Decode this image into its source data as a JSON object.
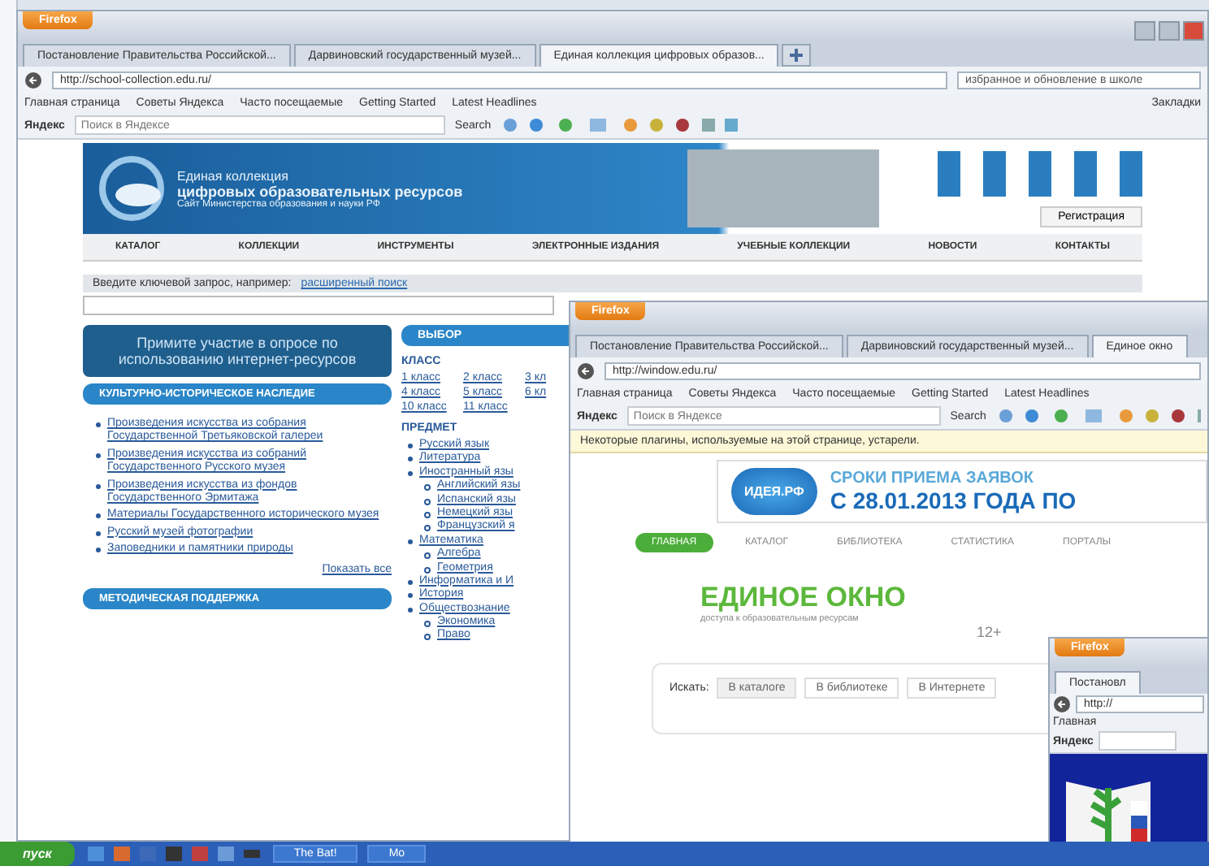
{
  "windows": [
    {
      "kind": "collection",
      "firefox_button": "Firefox",
      "tabs": [
        {
          "label": "Постановление Правительства Российской...",
          "selected": false
        },
        {
          "label": "Дарвиновский государственный музей...",
          "selected": false
        },
        {
          "label": "Единая коллекция цифровых образов...",
          "selected": true
        }
      ],
      "address": "http://school-collection.edu.ru/",
      "search_field": "избранное и обновление в школе",
      "bookmarks": [
        "Главная страница",
        "Советы Яндекса",
        "Часто посещаемые",
        "Getting Started",
        "Latest Headlines"
      ],
      "bookmarks_button": "Закладки",
      "yandex": {
        "label": "Яндекс",
        "placeholder": "Поиск в Яндексе",
        "search": "Search"
      },
      "page": {
        "header": {
          "title": "Единая коллекция",
          "subtitle": "цифровых образовательных ресурсов",
          "tagline": "Сайт Министерства образования и науки РФ",
          "register": "Регистрация"
        },
        "nav": [
          "КАТАЛОГ",
          "КОЛЛЕКЦИИ",
          "ИНСТРУМЕНТЫ",
          "ЭЛЕКТРОННЫЕ ИЗДАНИЯ",
          "УЧЕБНЫЕ КОЛЛЕКЦИИ",
          "НОВОСТИ",
          "КОНТАКТЫ"
        ],
        "search": {
          "label": "Введите ключевой запрос, например:",
          "link": "расширенный поиск"
        },
        "banner": "Примите участие в опросе по использованию интернет-ресурсов",
        "sections": [
          {
            "title": "КУЛЬТУРНО-ИСТОРИЧЕСКОЕ НАСЛЕДИЕ",
            "links": [
              "Произведения искусства из собрания Государственной Третьяковской галереи",
              "Произведения искусства из собраний Государственного Русского музея",
              "Произведения искусства из фондов Государственного Эрмитажа",
              "Материалы Государственного исторического музея",
              "Русский музей фотографии",
              "Заповедники и памятники природы"
            ],
            "more": "Показать все"
          },
          {
            "title": "МЕТОДИЧЕСКАЯ ПОДДЕРЖКА"
          }
        ],
        "sidebar": {
          "title": "ВЫБОР",
          "class_heading": "КЛАСС",
          "classes": [
            "1 класс",
            "2 класс",
            "3 кл",
            "4 класс",
            "5 класс",
            "6 кл",
            "10 класс",
            "11 класс"
          ],
          "subject_heading": "ПРЕДМЕТ",
          "subjects": [
            {
              "label": "Русский язык"
            },
            {
              "label": "Литература"
            },
            {
              "label": "Иностранный язы",
              "children": [
                {
                  "label": "Английский язы"
                },
                {
                  "label": "Испанский язы"
                },
                {
                  "label": "Немецкий язы"
                },
                {
                  "label": "Французский я"
                }
              ]
            },
            {
              "label": "Математика",
              "children": [
                {
                  "label": "Алгебра"
                },
                {
                  "label": "Геометрия"
                }
              ]
            },
            {
              "label": "Информатика и И"
            },
            {
              "label": "История"
            },
            {
              "label": "Обществознание",
              "children": [
                {
                  "label": "Экономика"
                },
                {
                  "label": "Право"
                }
              ]
            }
          ]
        }
      }
    },
    {
      "kind": "window",
      "firefox_button": "Firefox",
      "tabs": [
        {
          "label": "Постановление Правительства Российской...",
          "selected": false
        },
        {
          "label": "Дарвиновский государственный музей...",
          "selected": false
        },
        {
          "label": "Единое окно",
          "selected": true
        }
      ],
      "address": "http://window.edu.ru/",
      "bookmarks": [
        "Главная страница",
        "Советы Яндекса",
        "Часто посещаемые",
        "Getting Started",
        "Latest Headlines"
      ],
      "yandex": {
        "label": "Яндекс",
        "placeholder": "Поиск в Яндексе",
        "search": "Search"
      },
      "infobar": "Некоторые плагины, используемые на этой странице, устарели.",
      "page": {
        "promo": {
          "logo": "ИДЕЯ.РФ",
          "line1": "СРОКИ ПРИЕМА ЗАЯВОК",
          "line2": "С 28.01.2013 ГОДА ПО"
        },
        "nav": [
          {
            "label": "ГЛАВНАЯ",
            "selected": true
          },
          {
            "label": "КАТАЛОГ",
            "selected": false
          },
          {
            "label": "БИБЛИОТЕКА",
            "selected": false
          },
          {
            "label": "СТАТИСТИКА",
            "selected": false
          },
          {
            "label": "ПОРТАЛЫ",
            "selected": false
          }
        ],
        "title": "ЕДИНОЕ ОКНО",
        "subtitle": "доступа к образовательным ресурсам",
        "age": "12+",
        "search_label": "Искать:",
        "search_tabs": [
          {
            "label": "В каталоге",
            "selected": true
          },
          {
            "label": "В библиотеке",
            "selected": false
          },
          {
            "label": "В Интернете",
            "selected": false
          }
        ]
      }
    },
    {
      "kind": "small",
      "firefox_button": "Firefox",
      "tabs": [
        {
          "label": "Постановл",
          "selected": true
        }
      ],
      "address": "http://",
      "bookmarks": [
        "Главная"
      ],
      "yandex": {
        "label": "Яндекс"
      }
    }
  ],
  "taskbar": {
    "start": "пуск",
    "tasks": [
      "The Bat!",
      "Mo"
    ]
  }
}
